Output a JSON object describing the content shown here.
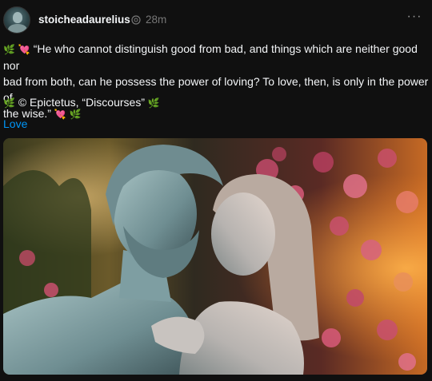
{
  "post": {
    "username": "stoicheadaurelius",
    "time_ago": "28m",
    "more_label": "···",
    "caption": {
      "leaf_emoji": "🌿",
      "heart_emoji": "💘",
      "line1": "“He who cannot distinguish good from bad, and things which are neither good nor",
      "line2": "bad from both, can he possess the power of loving? To love, then, is only in the power of",
      "line3": "the wise.”"
    },
    "attribution": "© Epictetus, “Discourses”",
    "tag": "Love"
  },
  "colors": {
    "background": "#101010",
    "text": "#f3f5f7",
    "muted": "#777777",
    "link": "#0095f6"
  },
  "icons": [
    "avatar",
    "clock-icon",
    "more-icon",
    "leaf-icon",
    "heart-icon"
  ]
}
